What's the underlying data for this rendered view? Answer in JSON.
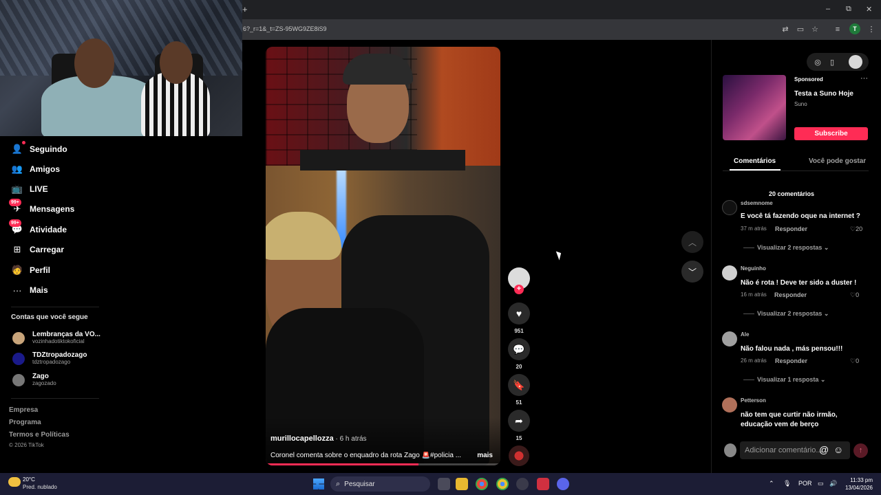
{
  "browser": {
    "url": "6?_r=1&_t=ZS-95WG9ZE8iS9",
    "new_tab": "+",
    "profile_initial": "T",
    "minimize": "–",
    "restore": "⧉",
    "close": "✕"
  },
  "sidebar": {
    "items": [
      {
        "label": "Seguindo",
        "icon": "person-follow-icon"
      },
      {
        "label": "Amigos",
        "icon": "friends-icon"
      },
      {
        "label": "LIVE",
        "icon": "live-icon"
      },
      {
        "label": "Mensagens",
        "icon": "message-icon",
        "badge": "99+"
      },
      {
        "label": "Atividade",
        "icon": "activity-icon",
        "badge": "99+"
      },
      {
        "label": "Carregar",
        "icon": "upload-icon"
      },
      {
        "label": "Perfil",
        "icon": "profile-icon"
      },
      {
        "label": "Mais",
        "icon": "more-icon"
      }
    ],
    "following_title": "Contas que você segue",
    "accounts": [
      {
        "name": "Lembranças da VO...",
        "handle": "vozinhadotiktokoficial"
      },
      {
        "name": "TDZtropadozago",
        "handle": "tdztropadozago"
      },
      {
        "name": "Zago",
        "handle": "zagozado"
      }
    ],
    "footer": [
      "Empresa",
      "Programa",
      "Termos e Políticas"
    ],
    "copyright": "© 2026 TikTok"
  },
  "video": {
    "username": "murillocapellozza",
    "time": " · 6 h atrás",
    "caption": "Coronel comenta sobre o enquadro da rota Zago 🚨#policia ...",
    "more": "mais",
    "progress": 0.65
  },
  "actions": {
    "likes": "951",
    "comments": "20",
    "saves": "51",
    "shares": "15"
  },
  "ad": {
    "sponsored": "Sponsored",
    "title": "Testa a Suno Hoje",
    "brand": "Suno",
    "cta": "Subscribe"
  },
  "tabs": {
    "comments": "Comentários",
    "you_may_like": "Você pode gostar"
  },
  "comments": {
    "count": "20 comentários",
    "reply_label": "Responder",
    "list": [
      {
        "user": "sdsemnome",
        "text": "E você tá fazendo oque na internet ?",
        "time": "37 m atrás",
        "likes": "20",
        "view_replies": "Visualizar 2 respostas"
      },
      {
        "user": "Neguinho",
        "text": "Não é rota ! Deve ter sido a duster !",
        "time": "16 m atrás",
        "likes": "0",
        "view_replies": "Visualizar 2 respostas"
      },
      {
        "user": "Ale",
        "text": "Não falou nada , más pensou!!!",
        "time": "26 m atrás",
        "likes": "0",
        "view_replies": "Visualizar 1 resposta"
      },
      {
        "user": "Petterson",
        "text": "não tem que curtir não irmão, educação vem de berço"
      }
    ],
    "add_placeholder": "Adicionar comentário..."
  },
  "taskbar": {
    "temp": "20°C",
    "weather": "Pred. nublado",
    "search": "Pesquisar",
    "lang": "POR",
    "time": "11:33 pm",
    "date": "13/04/2026"
  },
  "colors": {
    "accent": "#fe2c55",
    "background": "#000000",
    "taskbar": "#1c1d35"
  }
}
